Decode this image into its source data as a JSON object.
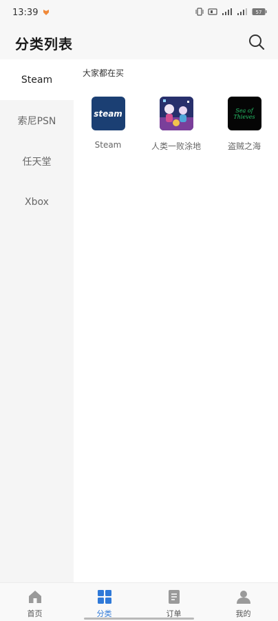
{
  "status_bar": {
    "time": "13:39",
    "battery": "57",
    "icons": [
      "vibrate-icon",
      "volte-icon",
      "signal-icon",
      "signal-icon",
      "battery-icon"
    ]
  },
  "header": {
    "title": "分类列表",
    "search_icon": "search-icon"
  },
  "sidebar": {
    "items": [
      {
        "label": "Steam",
        "active": true
      },
      {
        "label": "索尼PSN",
        "active": false
      },
      {
        "label": "任天堂",
        "active": false
      },
      {
        "label": "Xbox",
        "active": false
      }
    ]
  },
  "main": {
    "section_title": "大家都在买",
    "products": [
      {
        "name": "Steam",
        "thumb_text": "steam"
      },
      {
        "name": "人类一败涂地",
        "thumb_text": ""
      },
      {
        "name": "盗贼之海",
        "thumb_text": "Sea of Thieves"
      }
    ]
  },
  "bottom_nav": {
    "items": [
      {
        "label": "首页",
        "icon": "home-icon",
        "active": false
      },
      {
        "label": "分类",
        "icon": "grid-icon",
        "active": true
      },
      {
        "label": "订单",
        "icon": "document-icon",
        "active": false
      },
      {
        "label": "我的",
        "icon": "user-icon",
        "active": false
      }
    ]
  },
  "colors": {
    "accent": "#2f79d8",
    "inactive_icon": "#9a9a9a",
    "sidebar_bg": "#f5f5f5"
  }
}
